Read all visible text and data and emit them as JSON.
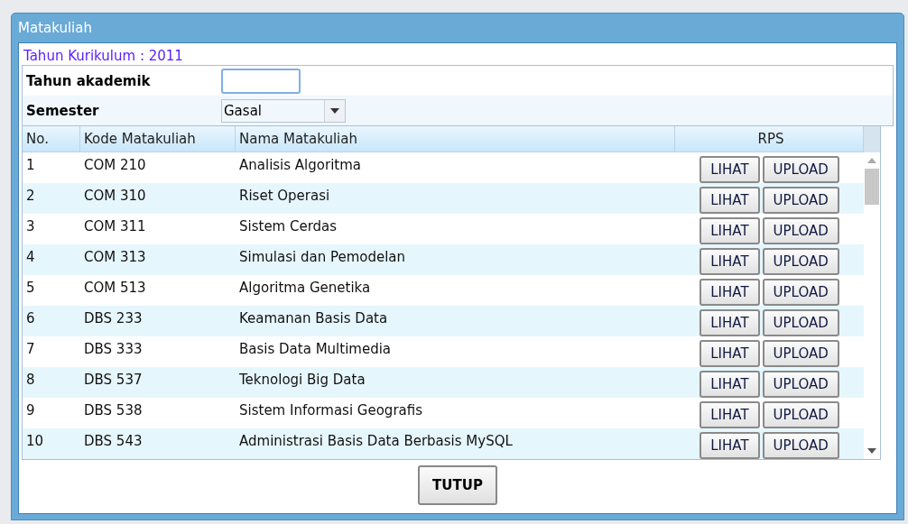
{
  "window": {
    "title": "Matakuliah"
  },
  "kurikulum": "Tahun Kurikulum : 2011",
  "form": {
    "tahun_label": "Tahun akademik",
    "semester_label": "Semester",
    "semester_value": "Gasal"
  },
  "table": {
    "columns": [
      "No.",
      "Kode Matakuliah",
      "Nama Matakuliah",
      "RPS"
    ],
    "rows": [
      {
        "no": "1",
        "kode": "COM 210",
        "nama": "Analisis Algoritma",
        "view": "LIHAT",
        "upload": "UPLOAD"
      },
      {
        "no": "2",
        "kode": "COM 310",
        "nama": "Riset Operasi",
        "view": "LIHAT",
        "upload": "UPLOAD"
      },
      {
        "no": "3",
        "kode": "COM 311",
        "nama": "Sistem Cerdas",
        "view": "LIHAT",
        "upload": "UPLOAD"
      },
      {
        "no": "4",
        "kode": "COM 313",
        "nama": "Simulasi dan Pemodelan",
        "view": "LIHAT",
        "upload": "UPLOAD"
      },
      {
        "no": "5",
        "kode": "COM 513",
        "nama": "Algoritma Genetika",
        "view": "LIHAT",
        "upload": "UPLOAD"
      },
      {
        "no": "6",
        "kode": "DBS 233",
        "nama": "Keamanan Basis Data",
        "view": "LIHAT",
        "upload": "UPLOAD"
      },
      {
        "no": "7",
        "kode": "DBS 333",
        "nama": "Basis Data Multimedia",
        "view": "LIHAT",
        "upload": "UPLOAD"
      },
      {
        "no": "8",
        "kode": "DBS 537",
        "nama": "Teknologi Big Data",
        "view": "LIHAT",
        "upload": "UPLOAD"
      },
      {
        "no": "9",
        "kode": "DBS 538",
        "nama": "Sistem Informasi Geografis",
        "view": "LIHAT",
        "upload": "UPLOAD"
      },
      {
        "no": "10",
        "kode": "DBS 543",
        "nama": "Administrasi Basis Data Berbasis MySQL",
        "view": "LIHAT",
        "upload": "UPLOAD"
      }
    ]
  },
  "close_button": "TUTUP"
}
